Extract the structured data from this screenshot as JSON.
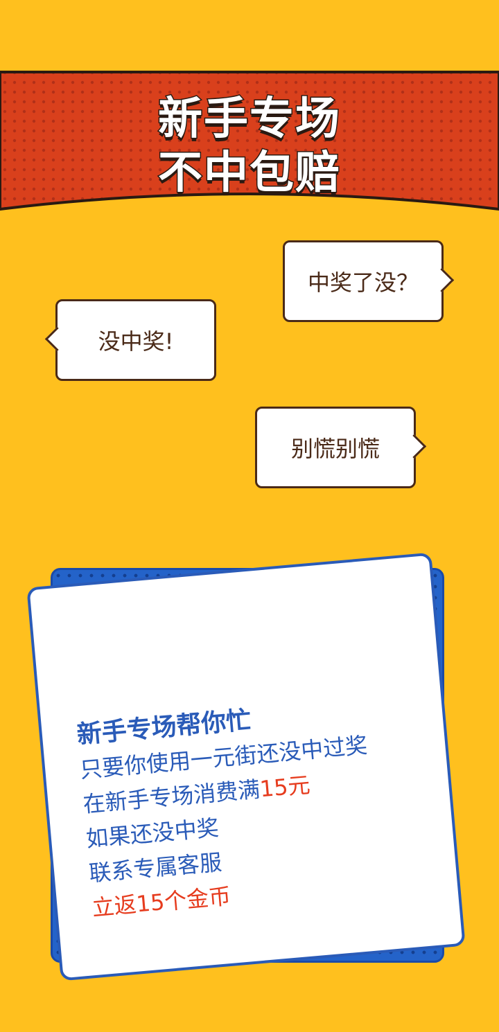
{
  "banner": {
    "title_line1": "新手专场",
    "title_line2": "不中包赔",
    "colors": {
      "banner": "#D9401C",
      "dots": "#B8301A",
      "outline": "#2a1a12"
    }
  },
  "bubbles": [
    {
      "text": "中奖了没？",
      "tail": "right"
    },
    {
      "text": "没中奖!",
      "tail": "left"
    },
    {
      "text": "别慌别慌",
      "tail": "right"
    }
  ],
  "card": {
    "heading": "新手专场帮你忙",
    "line2": "只要你使用一元街还没中过奖",
    "line3_prefix": "在新手专场消费满",
    "line3_amount": "15元",
    "line4": "如果还没中奖",
    "line5": "联系专属客服",
    "line6": "立返15个金币",
    "colors": {
      "text": "#2a5bb8",
      "highlight": "#E63C1E",
      "back": "#2463C9"
    }
  },
  "page": {
    "background": "#FFC01E"
  }
}
